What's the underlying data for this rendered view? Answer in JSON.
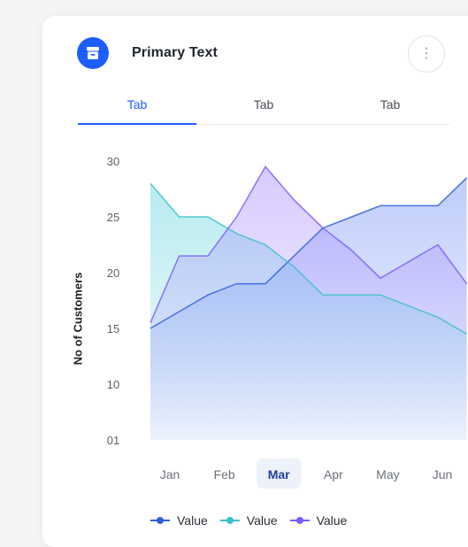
{
  "header": {
    "title": "Primary Text",
    "icon": "archive-icon",
    "more_icon": "more-vertical-icon",
    "more_glyph": "⋮"
  },
  "tabs": [
    {
      "label": "Tab",
      "active": true
    },
    {
      "label": "Tab",
      "active": false
    },
    {
      "label": "Tab",
      "active": false
    }
  ],
  "colors": {
    "accent": "#1e5eff",
    "series_blue": "#2f5ee0",
    "series_teal": "#3bbfcc",
    "series_purple": "#7a5cff"
  },
  "chart_data": {
    "type": "area",
    "categories": [
      "Jan",
      "Feb",
      "Mar",
      "Apr",
      "May",
      "Jun"
    ],
    "highlight_category": "Mar",
    "ylabel": "No of Customers",
    "y_tick_labels": [
      "01",
      "10",
      "15",
      "20",
      "25",
      "30"
    ],
    "y_tick_values": [
      5,
      10,
      15,
      20,
      25,
      30
    ],
    "ylim": [
      5,
      30
    ],
    "grid": false,
    "legend_position": "bottom",
    "x": [
      0,
      0.5,
      1,
      1.5,
      2,
      2.5,
      3,
      3.5,
      4,
      4.5,
      5,
      5.5
    ],
    "series": [
      {
        "name": "Value",
        "color": "#2f5ee0",
        "values": [
          15,
          16.5,
          18,
          19,
          19,
          21.5,
          24,
          25,
          26,
          26,
          26,
          28.5
        ]
      },
      {
        "name": "Value",
        "color": "#3bbfcc",
        "values": [
          28,
          25,
          25,
          23.5,
          22.5,
          20.5,
          18,
          18,
          18,
          17,
          16,
          14.5
        ]
      },
      {
        "name": "Value",
        "color": "#7a5cff",
        "values": [
          15.5,
          21.5,
          21.5,
          25,
          29.5,
          26.5,
          24,
          22,
          19.5,
          21,
          22.5,
          19
        ]
      }
    ]
  }
}
